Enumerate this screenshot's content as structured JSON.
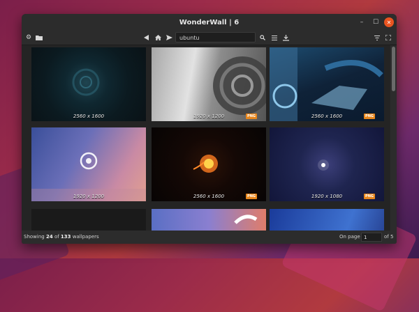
{
  "window": {
    "title": "WonderWall | 6"
  },
  "toolbar": {
    "search_value": "ubuntu"
  },
  "thumbnails": [
    {
      "resolution": "2560 x 1600",
      "badge": ""
    },
    {
      "resolution": "1920 x 1200",
      "badge": "PNG"
    },
    {
      "resolution": "2560 x 1600",
      "badge": "PNG"
    },
    {
      "resolution": "1920 x 1200",
      "badge": ""
    },
    {
      "resolution": "2560 x 1600",
      "badge": "PNG"
    },
    {
      "resolution": "1920 x 1080",
      "badge": "PNG"
    },
    {
      "resolution": "",
      "badge": ""
    },
    {
      "resolution": "",
      "badge": ""
    },
    {
      "resolution": "",
      "badge": ""
    }
  ],
  "status": {
    "showing_label": "Showing",
    "shown_count": "24",
    "of_label": "of",
    "total_count": "133",
    "wallpapers_label": "wallpapers",
    "on_page_label": "On page",
    "current_page": "1",
    "of_pages_label": "of 5"
  },
  "colors": {
    "accent": "#e95420",
    "badge": "#e8861c"
  }
}
